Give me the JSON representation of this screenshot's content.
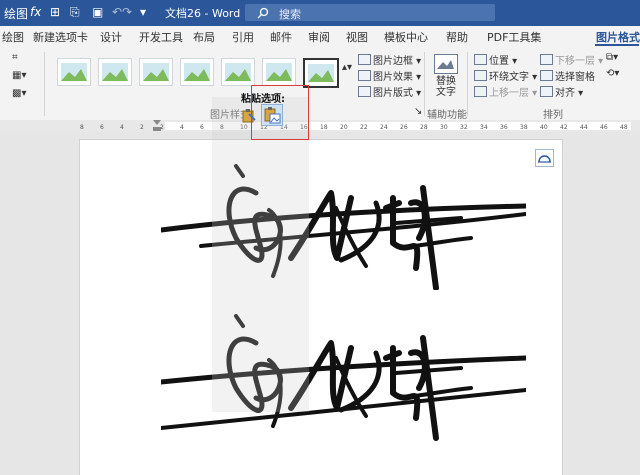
{
  "titlebar": {
    "quick_access": [
      "绘图",
      "fx"
    ],
    "doc_title": "文档26  -  Word",
    "search_placeholder": "搜索"
  },
  "tabs": [
    "绘图",
    "新建选项卡",
    "设计",
    "开发工具",
    "布局",
    "引用",
    "邮件",
    "审阅",
    "视图",
    "模板中心",
    "帮助",
    "PDF工具集",
    "图片格式"
  ],
  "active_tab": "图片格式",
  "ribbon": {
    "picture_styles_label": "图片样式",
    "border": "图片边框",
    "effects": "图片效果",
    "layout": "图片版式",
    "alt_text": "替换\n文字",
    "accessibility_label": "辅助功能",
    "position": "位置",
    "wrap_text": "环绕文字",
    "bring_forward": "上移一层",
    "send_backward": "下移一层",
    "selection_pane": "选择窗格",
    "align": "对齐",
    "arrange_label": "排列"
  },
  "paste_options": {
    "label": "粘贴选项:"
  },
  "ruler_ticks": [
    "8",
    "6",
    "4",
    "2",
    "2",
    "4",
    "6",
    "8",
    "10",
    "12",
    "14",
    "16",
    "18",
    "20",
    "22",
    "24",
    "26",
    "28",
    "30",
    "32",
    "34",
    "36",
    "38",
    "40",
    "42",
    "44",
    "46",
    "48"
  ],
  "colors": {
    "accent": "#2b579a",
    "highlight": "#d93a3a"
  }
}
